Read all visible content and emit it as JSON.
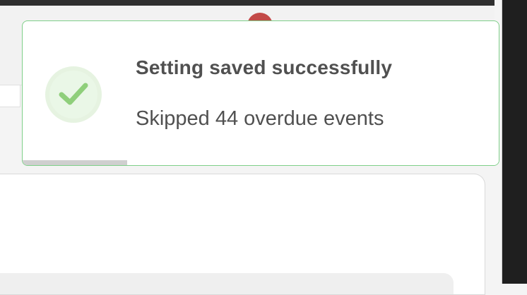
{
  "toast": {
    "title": "Setting saved successfully",
    "message": "Skipped 44 overdue events",
    "status": "success",
    "icon": "check-circle-icon",
    "progress": 0.22,
    "accent_color": "#7fcf89"
  },
  "header": {
    "avatar_color": "#c34a48"
  }
}
